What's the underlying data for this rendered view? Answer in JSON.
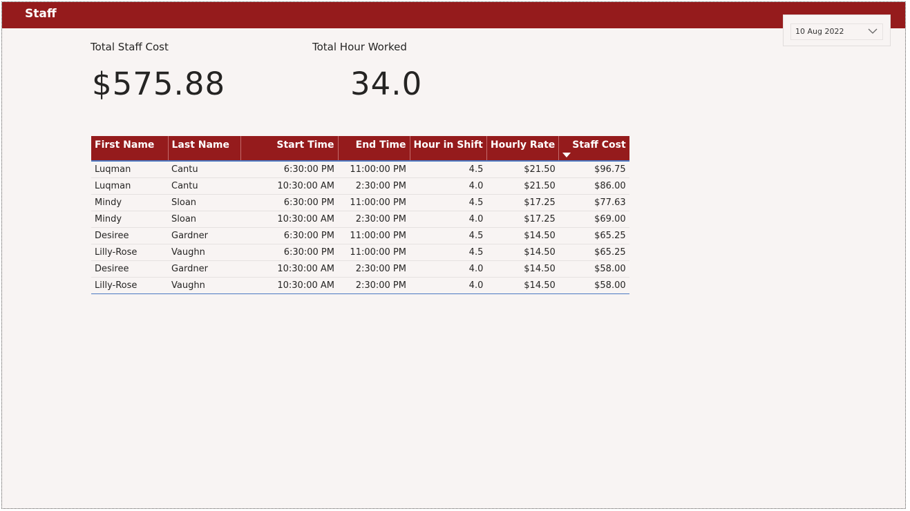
{
  "header": {
    "title": "Staff"
  },
  "slicer": {
    "selected_date": "10 Aug 2022"
  },
  "cards": {
    "total_staff_cost": {
      "label": "Total Staff Cost",
      "value": "$575.88"
    },
    "total_hour_worked": {
      "label": "Total Hour Worked",
      "value": "34.0"
    }
  },
  "table": {
    "columns": [
      "First Name",
      "Last Name",
      "Start Time",
      "End Time",
      "Hour in Shift",
      "Hourly Rate",
      "Staff Cost"
    ],
    "sorted_column": "Staff Cost",
    "sort_direction": "descending",
    "rows": [
      [
        "Luqman",
        "Cantu",
        "6:30:00 PM",
        "11:00:00 PM",
        "4.5",
        "$21.50",
        "$96.75"
      ],
      [
        "Luqman",
        "Cantu",
        "10:30:00 AM",
        "2:30:00 PM",
        "4.0",
        "$21.50",
        "$86.00"
      ],
      [
        "Mindy",
        "Sloan",
        "6:30:00 PM",
        "11:00:00 PM",
        "4.5",
        "$17.25",
        "$77.63"
      ],
      [
        "Mindy",
        "Sloan",
        "10:30:00 AM",
        "2:30:00 PM",
        "4.0",
        "$17.25",
        "$69.00"
      ],
      [
        "Desiree",
        "Gardner",
        "6:30:00 PM",
        "11:00:00 PM",
        "4.5",
        "$14.50",
        "$65.25"
      ],
      [
        "Lilly-Rose",
        "Vaughn",
        "6:30:00 PM",
        "11:00:00 PM",
        "4.5",
        "$14.50",
        "$65.25"
      ],
      [
        "Desiree",
        "Gardner",
        "10:30:00 AM",
        "2:30:00 PM",
        "4.0",
        "$14.50",
        "$58.00"
      ],
      [
        "Lilly-Rose",
        "Vaughn",
        "10:30:00 AM",
        "2:30:00 PM",
        "4.0",
        "$14.50",
        "$58.00"
      ]
    ]
  },
  "colors": {
    "accent": "#951b1c",
    "canvas": "#f8f4f3",
    "table_rule": "#4a78c2"
  },
  "icons": {
    "slicer_dropdown": "chevron-down-icon",
    "sort_indicator": "sort-descending-icon"
  }
}
